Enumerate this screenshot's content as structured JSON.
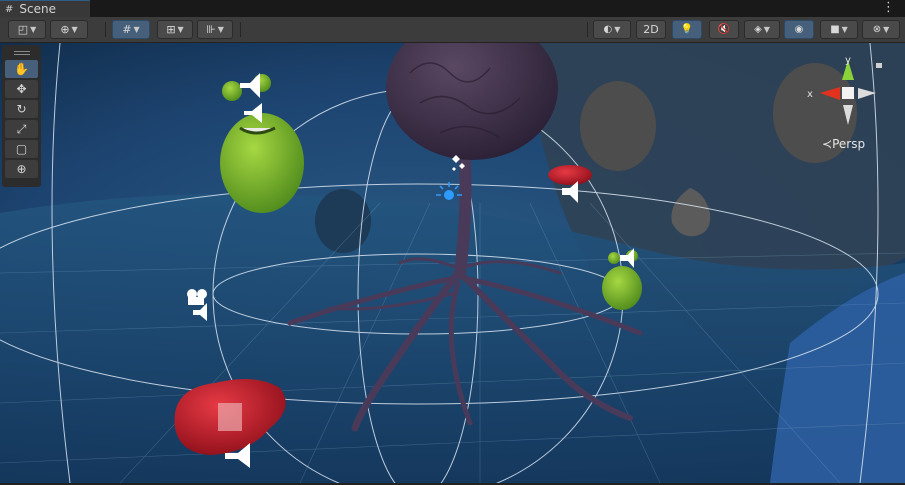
{
  "window": {
    "tab_title": "Scene",
    "tab_icon": "#",
    "menu_icon": "⋮"
  },
  "toolbar": {
    "left": [
      {
        "name": "draw-mode-button",
        "icon": "shaded-icon",
        "glyph": "◰",
        "dropdown": true,
        "active": false
      },
      {
        "name": "global-pivot-button",
        "icon": "globe-icon",
        "glyph": "⊕",
        "dropdown": true,
        "active": false
      },
      {
        "name": "grid-snap-button",
        "icon": "grid-icon",
        "glyph": "#",
        "dropdown": true,
        "active": true
      },
      {
        "name": "snap-increment-button",
        "icon": "snap-icon",
        "glyph": "⊞",
        "dropdown": true,
        "active": false
      },
      {
        "name": "ruler-button",
        "icon": "ruler-icon",
        "glyph": "⊪",
        "dropdown": true,
        "active": false
      }
    ],
    "right": [
      {
        "name": "shading-mode-button",
        "icon": "sphere-icon",
        "glyph": "◐",
        "dropdown": true,
        "active": false
      },
      {
        "name": "toggle-2d-button",
        "label": "2D",
        "active": false
      },
      {
        "name": "lighting-toggle-button",
        "icon": "lightbulb-icon",
        "glyph": "💡",
        "active": true
      },
      {
        "name": "audio-toggle-button",
        "icon": "speaker-mute-icon",
        "glyph": "🔇",
        "active": false
      },
      {
        "name": "effects-button",
        "icon": "layers-icon",
        "glyph": "◈",
        "dropdown": true,
        "active": false
      },
      {
        "name": "visibility-toggle-button",
        "icon": "eye-hidden-icon",
        "glyph": "◉",
        "active": true
      },
      {
        "name": "camera-button",
        "icon": "camera-icon",
        "glyph": "■",
        "dropdown": true,
        "active": false
      },
      {
        "name": "gizmos-button",
        "icon": "gizmo-icon",
        "glyph": "⊗",
        "dropdown": true,
        "active": false
      }
    ]
  },
  "tools": [
    {
      "name": "view-tool",
      "icon": "hand-icon",
      "glyph": "✋",
      "active": true
    },
    {
      "name": "move-tool",
      "icon": "move-arrows-icon",
      "glyph": "✥",
      "active": false
    },
    {
      "name": "rotate-tool",
      "icon": "rotate-icon",
      "glyph": "↻",
      "active": false
    },
    {
      "name": "scale-tool",
      "icon": "scale-icon",
      "glyph": "⤢",
      "active": false
    },
    {
      "name": "rect-tool",
      "icon": "rect-icon",
      "glyph": "▢",
      "active": false
    },
    {
      "name": "transform-tool",
      "icon": "transform-icon",
      "glyph": "⊕",
      "active": false
    }
  ],
  "orientation_gizmo": {
    "projection_label": "Persp",
    "axis_y": "y",
    "axis_x": "x",
    "colors": {
      "y": "#8bd13a",
      "x": "#e2311c",
      "z": "#3a7bd5"
    }
  }
}
